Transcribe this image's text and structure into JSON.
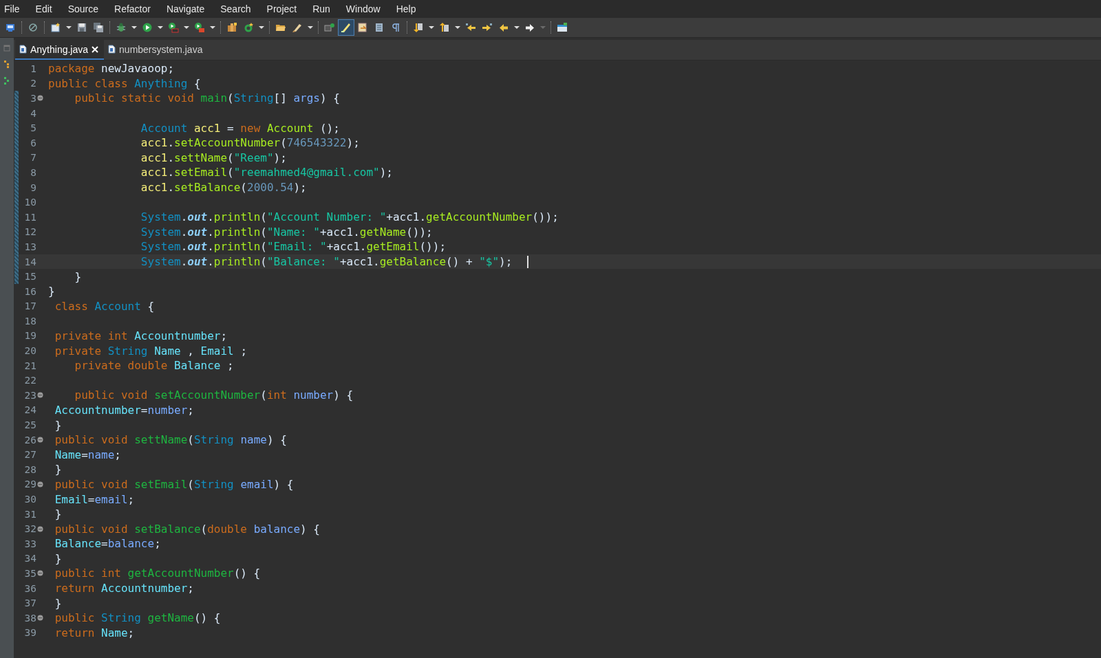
{
  "menu": [
    {
      "label": "File"
    },
    {
      "label": "Edit"
    },
    {
      "label": "Source"
    },
    {
      "label": "Refactor"
    },
    {
      "label": "Navigate"
    },
    {
      "label": "Search"
    },
    {
      "label": "Project"
    },
    {
      "label": "Run"
    },
    {
      "label": "Window"
    },
    {
      "label": "Help"
    }
  ],
  "tabs": [
    {
      "label": "Anything.java",
      "selected": true
    },
    {
      "label": "numbersystem.java",
      "selected": false
    }
  ],
  "lines": [
    {
      "n": "1",
      "fold": false,
      "changed": false,
      "selected": false,
      "tokens": [
        {
          "kind": "kw",
          "text": "package "
        },
        {
          "kind": "plain",
          "text": "newJavaoop;"
        }
      ]
    },
    {
      "n": "2",
      "fold": false,
      "changed": false,
      "selected": false,
      "tokens": [
        {
          "kind": "kw",
          "text": "public class "
        },
        {
          "kind": "type",
          "text": "Anything "
        },
        {
          "kind": "plain",
          "text": "{"
        }
      ]
    },
    {
      "n": "3",
      "fold": true,
      "changed": true,
      "selected": false,
      "tokens": [
        {
          "kind": "kw",
          "text": "    public static void "
        },
        {
          "kind": "decl",
          "text": "main"
        },
        {
          "kind": "plain",
          "text": "("
        },
        {
          "kind": "type",
          "text": "String"
        },
        {
          "kind": "plain",
          "text": "[] "
        },
        {
          "kind": "param",
          "text": "args"
        },
        {
          "kind": "plain",
          "text": ") {"
        }
      ]
    },
    {
      "n": "4",
      "fold": false,
      "changed": true,
      "selected": false
    },
    {
      "n": "5",
      "fold": false,
      "changed": true,
      "selected": false,
      "tokens": [
        {
          "kind": "type",
          "text": "              Account "
        },
        {
          "kind": "local",
          "text": "acc1"
        },
        {
          "kind": "plain",
          "text": " = "
        },
        {
          "kind": "kw",
          "text": "new "
        },
        {
          "kind": "type2",
          "text": "Account"
        },
        {
          "kind": "plain",
          "text": " ();"
        }
      ]
    },
    {
      "n": "6",
      "fold": false,
      "changed": true,
      "selected": false,
      "tokens": [
        {
          "kind": "local",
          "text": "              acc1"
        },
        {
          "kind": "plain",
          "text": "."
        },
        {
          "kind": "call",
          "text": "setAccountNumber"
        },
        {
          "kind": "plain",
          "text": "("
        },
        {
          "kind": "num",
          "text": "746543322"
        },
        {
          "kind": "plain",
          "text": ");"
        }
      ]
    },
    {
      "n": "7",
      "fold": false,
      "changed": true,
      "selected": false,
      "tokens": [
        {
          "kind": "local",
          "text": "              acc1"
        },
        {
          "kind": "plain",
          "text": "."
        },
        {
          "kind": "call",
          "text": "settName"
        },
        {
          "kind": "plain",
          "text": "("
        },
        {
          "kind": "str",
          "text": "\"Reem\""
        },
        {
          "kind": "plain",
          "text": ");"
        }
      ]
    },
    {
      "n": "8",
      "fold": false,
      "changed": true,
      "selected": false,
      "tokens": [
        {
          "kind": "local",
          "text": "              acc1"
        },
        {
          "kind": "plain",
          "text": "."
        },
        {
          "kind": "call",
          "text": "setEmail"
        },
        {
          "kind": "plain",
          "text": "("
        },
        {
          "kind": "str",
          "text": "\"reemahmed4@gmail.com\""
        },
        {
          "kind": "plain",
          "text": ");"
        }
      ]
    },
    {
      "n": "9",
      "fold": false,
      "changed": true,
      "selected": false,
      "tokens": [
        {
          "kind": "local",
          "text": "              acc1"
        },
        {
          "kind": "plain",
          "text": "."
        },
        {
          "kind": "call",
          "text": "setBalance"
        },
        {
          "kind": "plain",
          "text": "("
        },
        {
          "kind": "num",
          "text": "2000.54"
        },
        {
          "kind": "plain",
          "text": ");"
        }
      ]
    },
    {
      "n": "10",
      "fold": false,
      "changed": true,
      "selected": false
    },
    {
      "n": "11",
      "fold": false,
      "changed": true,
      "selected": false,
      "tokens": [
        {
          "kind": "type",
          "text": "              System"
        },
        {
          "kind": "plain",
          "text": "."
        },
        {
          "kind": "static",
          "text": "out"
        },
        {
          "kind": "plain",
          "text": "."
        },
        {
          "kind": "call",
          "text": "println"
        },
        {
          "kind": "plain",
          "text": "("
        },
        {
          "kind": "str",
          "text": "\"Account Number: \""
        },
        {
          "kind": "plain",
          "text": "+acc1."
        },
        {
          "kind": "call",
          "text": "getAccountNumber"
        },
        {
          "kind": "plain",
          "text": "());"
        }
      ]
    },
    {
      "n": "12",
      "fold": false,
      "changed": true,
      "selected": false,
      "tokens": [
        {
          "kind": "type",
          "text": "              System"
        },
        {
          "kind": "plain",
          "text": "."
        },
        {
          "kind": "static",
          "text": "out"
        },
        {
          "kind": "plain",
          "text": "."
        },
        {
          "kind": "call",
          "text": "println"
        },
        {
          "kind": "plain",
          "text": "("
        },
        {
          "kind": "str",
          "text": "\"Name: \""
        },
        {
          "kind": "plain",
          "text": "+acc1."
        },
        {
          "kind": "call",
          "text": "getName"
        },
        {
          "kind": "plain",
          "text": "());"
        }
      ]
    },
    {
      "n": "13",
      "fold": false,
      "changed": true,
      "selected": false,
      "tokens": [
        {
          "kind": "type",
          "text": "              System"
        },
        {
          "kind": "plain",
          "text": "."
        },
        {
          "kind": "static",
          "text": "out"
        },
        {
          "kind": "plain",
          "text": "."
        },
        {
          "kind": "call",
          "text": "println"
        },
        {
          "kind": "plain",
          "text": "("
        },
        {
          "kind": "str",
          "text": "\"Email: \""
        },
        {
          "kind": "plain",
          "text": "+acc1."
        },
        {
          "kind": "call",
          "text": "getEmail"
        },
        {
          "kind": "plain",
          "text": "());"
        }
      ]
    },
    {
      "n": "14",
      "fold": false,
      "changed": true,
      "selected": true,
      "tokens": [
        {
          "kind": "type",
          "text": "              System"
        },
        {
          "kind": "plain",
          "text": "."
        },
        {
          "kind": "static",
          "text": "out"
        },
        {
          "kind": "plain",
          "text": "."
        },
        {
          "kind": "call",
          "text": "println"
        },
        {
          "kind": "plain",
          "text": "("
        },
        {
          "kind": "str",
          "text": "\"Balance: \""
        },
        {
          "kind": "plain",
          "text": "+acc1."
        },
        {
          "kind": "call",
          "text": "getBalance"
        },
        {
          "kind": "plain",
          "text": "() + "
        },
        {
          "kind": "str",
          "text": "\"$\""
        },
        {
          "kind": "plain",
          "text": ");"
        }
      ]
    },
    {
      "n": "15",
      "fold": false,
      "changed": true,
      "selected": false,
      "tokens": [
        {
          "kind": "plain",
          "text": "    }"
        }
      ]
    },
    {
      "n": "16",
      "fold": false,
      "changed": false,
      "selected": false,
      "tokens": [
        {
          "kind": "plain",
          "text": "}"
        }
      ]
    },
    {
      "n": "17",
      "fold": false,
      "changed": false,
      "selected": false,
      "tokens": [
        {
          "kind": "kw",
          "text": " class "
        },
        {
          "kind": "type",
          "text": "Account "
        },
        {
          "kind": "plain",
          "text": "{"
        }
      ]
    },
    {
      "n": "18",
      "fold": false,
      "changed": false,
      "selected": false
    },
    {
      "n": "19",
      "fold": false,
      "changed": false,
      "selected": false,
      "tokens": [
        {
          "kind": "kw",
          "text": " private int "
        },
        {
          "kind": "field",
          "text": "Accountnumber"
        },
        {
          "kind": "plain",
          "text": ";"
        }
      ]
    },
    {
      "n": "20",
      "fold": false,
      "changed": false,
      "selected": false,
      "tokens": [
        {
          "kind": "kw",
          "text": " private "
        },
        {
          "kind": "type",
          "text": "String "
        },
        {
          "kind": "field",
          "text": "Name"
        },
        {
          "kind": "plain",
          "text": " , "
        },
        {
          "kind": "field",
          "text": "Email"
        },
        {
          "kind": "plain",
          "text": " ;"
        }
      ]
    },
    {
      "n": "21",
      "fold": false,
      "changed": false,
      "selected": false,
      "tokens": [
        {
          "kind": "kw",
          "text": "    private double "
        },
        {
          "kind": "field",
          "text": "Balance"
        },
        {
          "kind": "plain",
          "text": " ;"
        }
      ]
    },
    {
      "n": "22",
      "fold": false,
      "changed": false,
      "selected": false
    },
    {
      "n": "23",
      "fold": true,
      "changed": false,
      "selected": false,
      "tokens": [
        {
          "kind": "kw",
          "text": "    public void "
        },
        {
          "kind": "decl",
          "text": "setAccountNumber"
        },
        {
          "kind": "plain",
          "text": "("
        },
        {
          "kind": "kw",
          "text": "int "
        },
        {
          "kind": "param",
          "text": "number"
        },
        {
          "kind": "plain",
          "text": ") {"
        }
      ]
    },
    {
      "n": "24",
      "fold": false,
      "changed": false,
      "selected": false,
      "tokens": [
        {
          "kind": "field",
          "text": " Accountnumber"
        },
        {
          "kind": "plain",
          "text": "="
        },
        {
          "kind": "param",
          "text": "number"
        },
        {
          "kind": "plain",
          "text": ";"
        }
      ]
    },
    {
      "n": "25",
      "fold": false,
      "changed": false,
      "selected": false,
      "tokens": [
        {
          "kind": "plain",
          "text": " }"
        }
      ]
    },
    {
      "n": "26",
      "fold": true,
      "changed": false,
      "selected": false,
      "tokens": [
        {
          "kind": "kw",
          "text": " public void "
        },
        {
          "kind": "decl",
          "text": "settName"
        },
        {
          "kind": "plain",
          "text": "("
        },
        {
          "kind": "type",
          "text": "String "
        },
        {
          "kind": "param",
          "text": "name"
        },
        {
          "kind": "plain",
          "text": ") {"
        }
      ]
    },
    {
      "n": "27",
      "fold": false,
      "changed": false,
      "selected": false,
      "tokens": [
        {
          "kind": "field",
          "text": " Name"
        },
        {
          "kind": "plain",
          "text": "="
        },
        {
          "kind": "param",
          "text": "name"
        },
        {
          "kind": "plain",
          "text": ";"
        }
      ]
    },
    {
      "n": "28",
      "fold": false,
      "changed": false,
      "selected": false,
      "tokens": [
        {
          "kind": "plain",
          "text": " }"
        }
      ]
    },
    {
      "n": "29",
      "fold": true,
      "changed": false,
      "selected": false,
      "tokens": [
        {
          "kind": "kw",
          "text": " public void "
        },
        {
          "kind": "decl",
          "text": "setEmail"
        },
        {
          "kind": "plain",
          "text": "("
        },
        {
          "kind": "type",
          "text": "String "
        },
        {
          "kind": "param",
          "text": "email"
        },
        {
          "kind": "plain",
          "text": ") {"
        }
      ]
    },
    {
      "n": "30",
      "fold": false,
      "changed": false,
      "selected": false,
      "tokens": [
        {
          "kind": "field",
          "text": " Email"
        },
        {
          "kind": "plain",
          "text": "="
        },
        {
          "kind": "param",
          "text": "email"
        },
        {
          "kind": "plain",
          "text": ";"
        }
      ]
    },
    {
      "n": "31",
      "fold": false,
      "changed": false,
      "selected": false,
      "tokens": [
        {
          "kind": "plain",
          "text": " }"
        }
      ]
    },
    {
      "n": "32",
      "fold": true,
      "changed": false,
      "selected": false,
      "tokens": [
        {
          "kind": "kw",
          "text": " public void "
        },
        {
          "kind": "decl",
          "text": "setBalance"
        },
        {
          "kind": "plain",
          "text": "("
        },
        {
          "kind": "kw",
          "text": "double "
        },
        {
          "kind": "param",
          "text": "balance"
        },
        {
          "kind": "plain",
          "text": ") {"
        }
      ]
    },
    {
      "n": "33",
      "fold": false,
      "changed": false,
      "selected": false,
      "tokens": [
        {
          "kind": "field",
          "text": " Balance"
        },
        {
          "kind": "plain",
          "text": "="
        },
        {
          "kind": "param",
          "text": "balance"
        },
        {
          "kind": "plain",
          "text": ";"
        }
      ]
    },
    {
      "n": "34",
      "fold": false,
      "changed": false,
      "selected": false,
      "tokens": [
        {
          "kind": "plain",
          "text": " }"
        }
      ]
    },
    {
      "n": "35",
      "fold": true,
      "changed": false,
      "selected": false,
      "tokens": [
        {
          "kind": "kw",
          "text": " public int "
        },
        {
          "kind": "decl",
          "text": "getAccountNumber"
        },
        {
          "kind": "plain",
          "text": "() {"
        }
      ]
    },
    {
      "n": "36",
      "fold": false,
      "changed": false,
      "selected": false,
      "tokens": [
        {
          "kind": "kw",
          "text": " return "
        },
        {
          "kind": "field",
          "text": "Accountnumber"
        },
        {
          "kind": "plain",
          "text": ";"
        }
      ]
    },
    {
      "n": "37",
      "fold": false,
      "changed": false,
      "selected": false,
      "tokens": [
        {
          "kind": "plain",
          "text": " }"
        }
      ]
    },
    {
      "n": "38",
      "fold": true,
      "changed": false,
      "selected": false,
      "tokens": [
        {
          "kind": "kw",
          "text": " public "
        },
        {
          "kind": "type",
          "text": "String "
        },
        {
          "kind": "decl",
          "text": "getName"
        },
        {
          "kind": "plain",
          "text": "() {"
        }
      ]
    },
    {
      "n": "39",
      "fold": false,
      "changed": false,
      "selected": false,
      "tokens": [
        {
          "kind": "kw",
          "text": " return "
        },
        {
          "kind": "field",
          "text": "Name"
        },
        {
          "kind": "plain",
          "text": ";"
        }
      ]
    }
  ]
}
